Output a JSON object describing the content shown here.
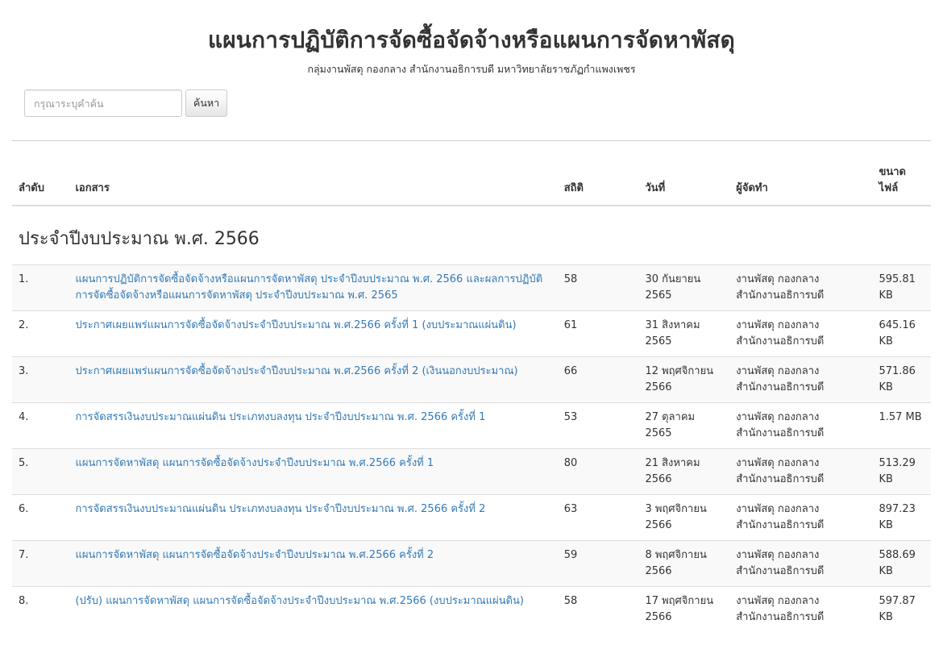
{
  "header": {
    "title": "แผนการปฏิบัติการจัดซื้อจัดจ้างหรือแผนการจัดหาพัสดุ",
    "subtitle": "กลุ่มงานพัสดุ กองกลาง สำนักงานอธิการบดี มหาวิทยาลัยราชภัฏกำแพงเพชร"
  },
  "search": {
    "placeholder": "กรุณาระบุคำค้น",
    "value": "",
    "button_label": "ค้นหา"
  },
  "table": {
    "columns": {
      "no": "ลำดับ",
      "document": "เอกสาร",
      "stats": "สถิติ",
      "date": "วันที่",
      "by": "ผู้จัดทำ",
      "size": "ขนาดไฟล์"
    },
    "group_title": "ประจำปีงบประมาณ พ.ศ. 2566",
    "rows": [
      {
        "no": "1.",
        "document": "แผนการปฏิบัติการจัดซื้อจัดจ้างหรือแผนการจัดหาพัสดุ ประจำปีงบประมาณ พ.ศ. 2566 และผลการปฏิบัติการจัดซื้อจัดจ้างหรือแผนการจัดหาพัสดุ ประจำปีงบประมาณ พ.ศ. 2565",
        "stats": "58",
        "date": "30 กันยายน 2565",
        "by": "งานพัสดุ กองกลาง สำนักงานอธิการบดี",
        "size": "595.81 KB"
      },
      {
        "no": "2.",
        "document": "ประกาศเผยแพร่แผนการจัดซื้อจัดจ้างประจำปีงบประมาณ พ.ศ.2566 ครั้งที่ 1 (งบประมาณแผ่นดิน)",
        "stats": "61",
        "date": "31 สิงหาคม 2565",
        "by": "งานพัสดุ กองกลาง สำนักงานอธิการบดี",
        "size": "645.16 KB"
      },
      {
        "no": "3.",
        "document": "ประกาศเผยแพร่แผนการจัดซื้อจัดจ้างประจำปีงบประมาณ พ.ศ.2566 ครั้งที่ 2 (เงินนอกงบประมาณ)",
        "stats": "66",
        "date": "12 พฤศจิกายน 2566",
        "by": "งานพัสดุ กองกลาง สำนักงานอธิการบดี",
        "size": "571.86 KB"
      },
      {
        "no": "4.",
        "document": "การจัดสรรเงินงบประมาณแผ่นดิน ประเภทงบลงทุน ประจำปีงบประมาณ พ.ศ. 2566 ครั้งที่ 1",
        "stats": "53",
        "date": "27 ตุลาคม 2565",
        "by": "งานพัสดุ กองกลาง สำนักงานอธิการบดี",
        "size": "1.57 MB"
      },
      {
        "no": "5.",
        "document": "แผนการจัดหาพัสดุ แผนการจัดซื้อจัดจ้างประจำปีงบประมาณ พ.ศ.2566 ครั้งที่ 1",
        "stats": "80",
        "date": "21 สิงหาคม 2566",
        "by": "งานพัสดุ กองกลาง สำนักงานอธิการบดี",
        "size": "513.29 KB"
      },
      {
        "no": "6.",
        "document": "การจัดสรรเงินงบประมาณแผ่นดิน ประเภทงบลงทุน ประจำปีงบประมาณ พ.ศ. 2566 ครั้งที่ 2",
        "stats": "63",
        "date": "3 พฤศจิกายน 2566",
        "by": "งานพัสดุ กองกลาง สำนักงานอธิการบดี",
        "size": "897.23 KB"
      },
      {
        "no": "7.",
        "document": "แผนการจัดหาพัสดุ แผนการจัดซื้อจัดจ้างประจำปีงบประมาณ พ.ศ.2566 ครั้งที่ 2",
        "stats": "59",
        "date": "8 พฤศจิกายน 2566",
        "by": "งานพัสดุ กองกลาง สำนักงานอธิการบดี",
        "size": "588.69 KB"
      },
      {
        "no": "8.",
        "document": "(ปรับ) แผนการจัดหาพัสดุ แผนการจัดซื้อจัดจ้างประจำปีงบประมาณ พ.ศ.2566 (งบประมาณแผ่นดิน)",
        "stats": "58",
        "date": "17 พฤศจิกายน 2566",
        "by": "งานพัสดุ กองกลาง สำนักงานอธิการบดี",
        "size": "597.87 KB"
      }
    ]
  }
}
